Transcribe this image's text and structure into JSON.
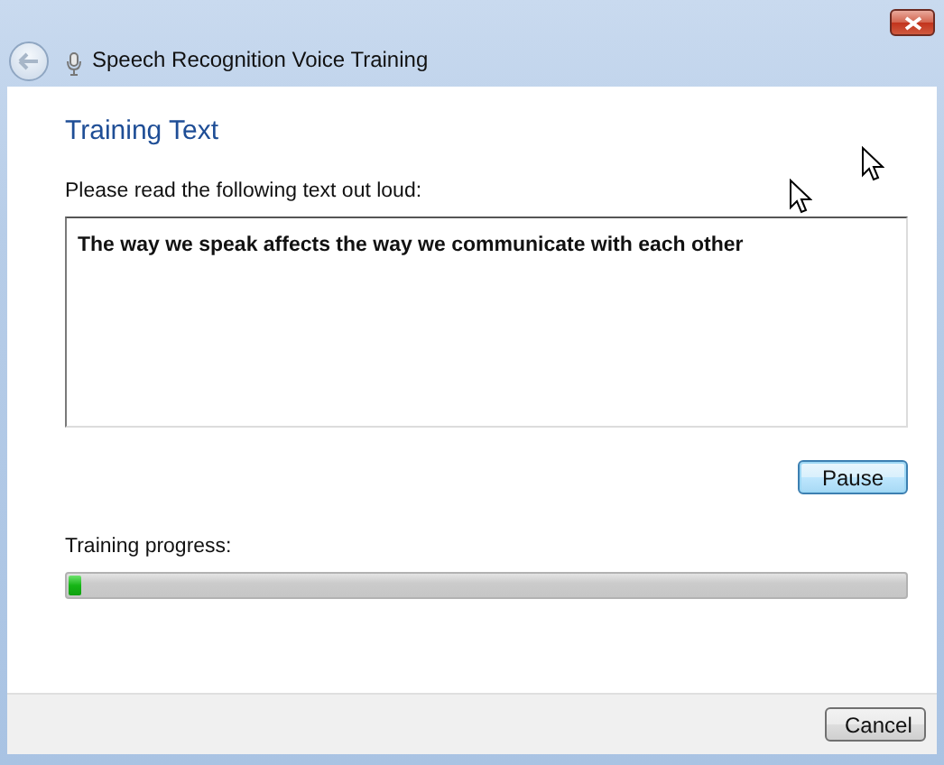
{
  "window": {
    "title": "Speech Recognition Voice Training"
  },
  "heading": "Training Text",
  "instruction": "Please read the following text out loud:",
  "training_text": "The way we speak affects the way we communicate with each other",
  "pause_button": {
    "label": "Pause",
    "focused": true
  },
  "progress": {
    "label": "Training progress:",
    "level": 0.015
  },
  "cancel_button": {
    "label": "Cancel",
    "focused": false
  }
}
